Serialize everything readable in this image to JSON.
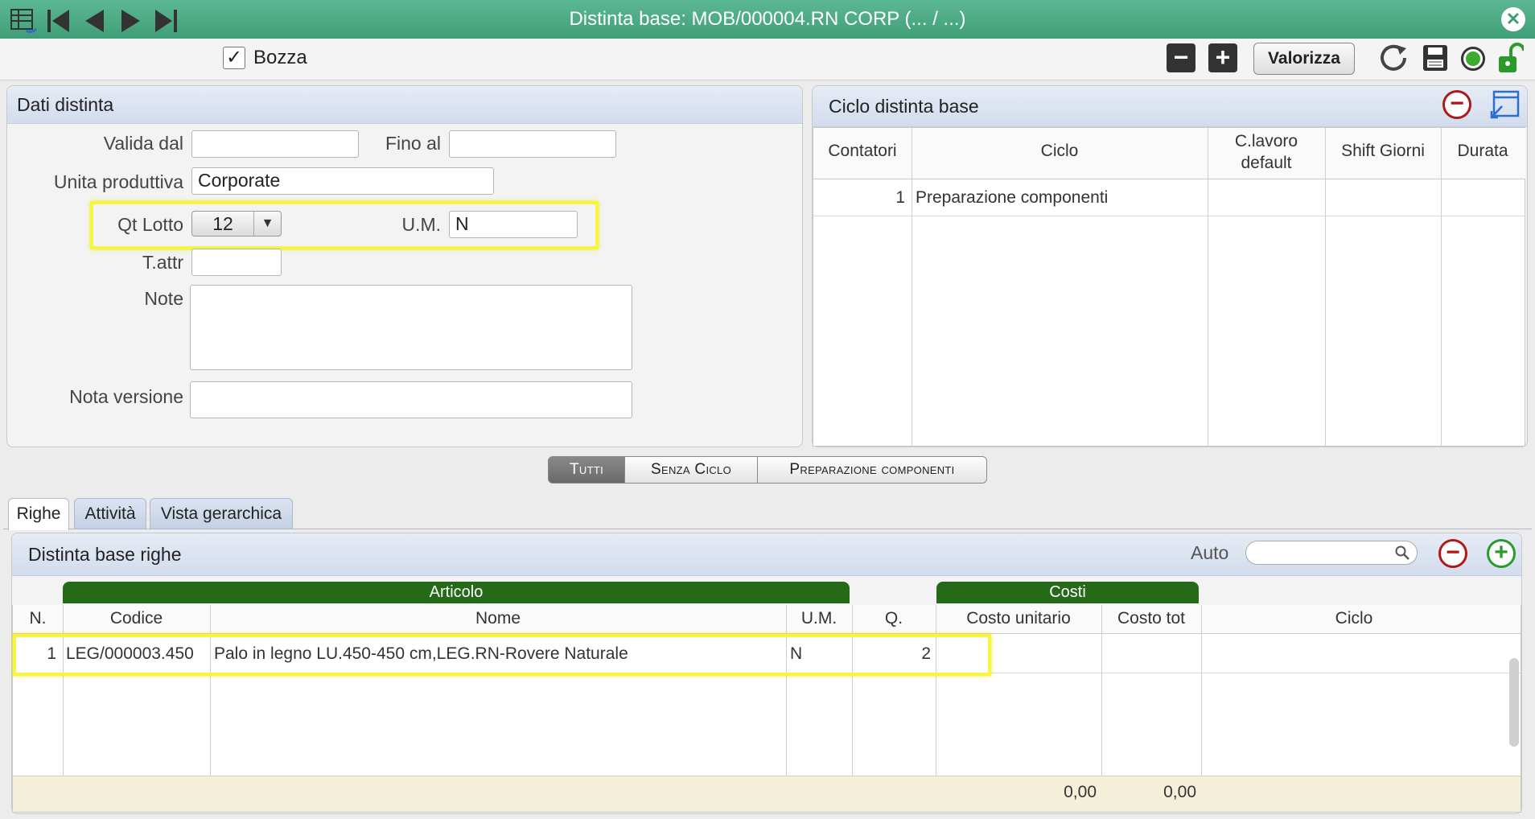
{
  "window": {
    "title": "Distinta base: MOB/000004.RN CORP (... / ...)"
  },
  "toolbar": {
    "bozza_label": "Bozza",
    "bozza_checked": true,
    "valorizza_label": "Valorizza"
  },
  "dati": {
    "title": "Dati distinta",
    "valida_dal_label": "Valida dal",
    "valida_dal_value": "",
    "fino_al_label": "Fino al",
    "fino_al_value": "",
    "unita_label": "Unita produttiva",
    "unita_value": "Corporate",
    "qt_lotto_label": "Qt Lotto",
    "qt_lotto_value": "12",
    "um_label": "U.M.",
    "um_value": "N",
    "tattr_label": "T.attr",
    "tattr_value": "",
    "note_label": "Note",
    "note_value": "",
    "nota_versione_label": "Nota versione",
    "nota_versione_value": ""
  },
  "ciclo": {
    "title": "Ciclo distinta base",
    "columns": [
      "Contatori",
      "Ciclo",
      "C.lavoro default",
      "Shift Giorni",
      "Durata"
    ],
    "rows": [
      {
        "contatori": "1",
        "ciclo": "Preparazione componenti",
        "clavoro": "",
        "shift": "",
        "durata": ""
      }
    ]
  },
  "filters": [
    "Tutti",
    "Senza Ciclo",
    "Preparazione componenti"
  ],
  "tabs": [
    "Righe",
    "Attività",
    "Vista gerarchica"
  ],
  "righe": {
    "title": "Distinta base righe",
    "auto_label": "Auto",
    "search_value": "",
    "group_articolo": "Articolo",
    "group_costi": "Costi",
    "columns": [
      "N.",
      "Codice",
      "Nome",
      "U.M.",
      "Q.",
      "Costo unitario",
      "Costo tot",
      "Ciclo"
    ],
    "rows": [
      {
        "n": "1",
        "codice": "LEG/000003.450",
        "nome": "Palo in legno LU.450-450 cm,LEG.RN-Rovere Naturale",
        "um": "N",
        "q": "2",
        "costo_unitario": "",
        "costo_tot": "",
        "ciclo": ""
      }
    ],
    "totals": {
      "costo_unitario": "0,00",
      "costo_tot": "0,00"
    }
  },
  "colors": {
    "title_bar": "#4caa85",
    "green_header": "#256a18",
    "highlight": "#f5f542"
  }
}
